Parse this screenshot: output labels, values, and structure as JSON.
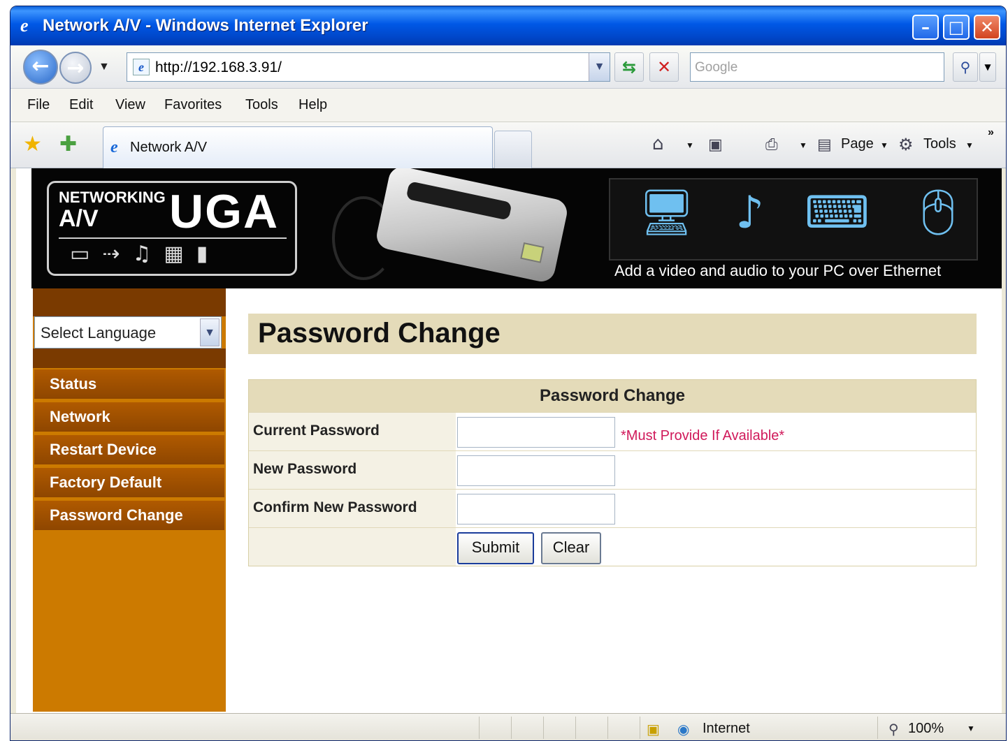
{
  "window": {
    "title": "Network A/V - Windows Internet Explorer"
  },
  "address_bar": {
    "url": "http://192.168.3.91/",
    "search_placeholder": "Google"
  },
  "menu": [
    "File",
    "Edit",
    "View",
    "Favorites",
    "Tools",
    "Help"
  ],
  "tab": {
    "title": "Network A/V"
  },
  "command_bar": {
    "page_label": "Page",
    "tools_label": "Tools"
  },
  "banner": {
    "logo_line1": "NETWORKING",
    "logo_line2": "A/V",
    "logo_brand": "UGA",
    "tagline": "Add a video and audio to your PC over Ethernet"
  },
  "sidebar": {
    "language_select": "Select Language",
    "items": [
      {
        "label": "Status"
      },
      {
        "label": "Network"
      },
      {
        "label": "Restart Device"
      },
      {
        "label": "Factory Default"
      },
      {
        "label": "Password Change"
      }
    ]
  },
  "content": {
    "page_title": "Password Change",
    "form_header": "Password Change",
    "current_password_label": "Current Password",
    "current_password_note": "*Must Provide If Available*",
    "new_password_label": "New Password",
    "confirm_password_label": "Confirm New Password",
    "submit_label": "Submit",
    "clear_label": "Clear"
  },
  "status_bar": {
    "zone": "Internet",
    "zoom": "100%"
  },
  "colors": {
    "sidebar": "#cc7a00",
    "nav_item": "#9a4e00",
    "title_band": "#e4dbb9",
    "note": "#d0195a"
  }
}
